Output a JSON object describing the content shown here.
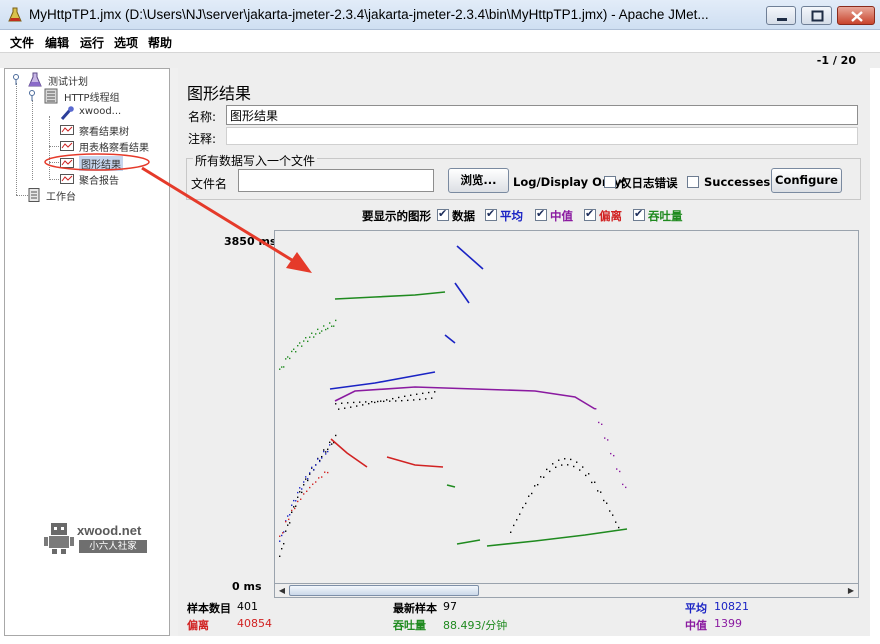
{
  "window": {
    "title": "MyHttpTP1.jmx (D:\\Users\\NJ\\server\\jakarta-jmeter-2.3.4\\jakarta-jmeter-2.3.4\\bin\\MyHttpTP1.jmx) - Apache JMet..."
  },
  "menu": {
    "items": [
      "文件",
      "编辑",
      "运行",
      "选项",
      "帮助"
    ]
  },
  "counter": "-1 / 20",
  "tree": {
    "root": "测试计划",
    "thread_group": "HTTP线程组",
    "children": [
      "xwood...",
      "察看结果树",
      "用表格察看结果",
      "图形结果",
      "聚合报告"
    ],
    "workbench": "工作台"
  },
  "watermark": {
    "logo": "xwood.net",
    "sub": "小六人社家"
  },
  "panel": {
    "title": "图形结果",
    "name_label": "名称:",
    "name_value": "图形结果",
    "comment_label": "注释:",
    "comment_value": "",
    "file_group_title": "所有数据写入一个文件",
    "file_label": "文件名",
    "file_value": "",
    "browse_button": "浏览...",
    "log_display_label": "Log/Display Only:",
    "errors_only_label": "仅日志错误",
    "successes_label": "Successes",
    "configure_button": "Configure"
  },
  "graph_options": {
    "label": "要显示的图形",
    "items": [
      {
        "label": "数据",
        "checked": true,
        "color": "#000000"
      },
      {
        "label": "平均",
        "checked": true,
        "color": "#1a23c4"
      },
      {
        "label": "中值",
        "checked": true,
        "color": "#8a1aa0"
      },
      {
        "label": "偏离",
        "checked": true,
        "color": "#d12222"
      },
      {
        "label": "吞吐量",
        "checked": true,
        "color": "#1f8a1f"
      }
    ]
  },
  "graph": {
    "ymax": "3850",
    "ymax_unit": "ms",
    "ymin": "0 ms"
  },
  "stats": {
    "samples_label": "样本数目",
    "samples_value": "401",
    "latest_label": "最新样本",
    "latest_value": "97",
    "avg_label": "平均",
    "avg_value": "10821",
    "deviation_label": "偏离",
    "deviation_value": "40854",
    "throughput_label": "吞吐量",
    "throughput_value": "88.493/分钟",
    "median_label": "中值",
    "median_value": "1399"
  },
  "colors": {
    "data": "#000000",
    "average": "#1a23c4",
    "median": "#8a1aa0",
    "deviation": "#d12222",
    "throughput": "#1f8a1f",
    "annotation": "#e53a2a"
  }
}
